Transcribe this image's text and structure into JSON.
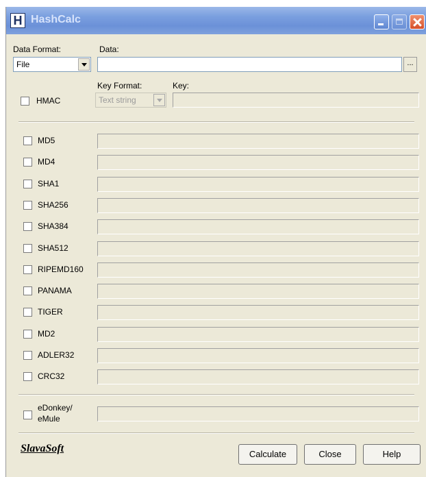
{
  "window": {
    "title": "HashCalc",
    "icon_letter": "H"
  },
  "data_format": {
    "label": "Data Format:",
    "selected": "File"
  },
  "data": {
    "label": "Data:",
    "value": "",
    "browse_label": "..."
  },
  "hmac": {
    "label": "HMAC",
    "key_format_label": "Key Format:",
    "key_format_selected": "Text string",
    "key_label": "Key:"
  },
  "algorithms": [
    {
      "label": "MD5"
    },
    {
      "label": "MD4"
    },
    {
      "label": "SHA1"
    },
    {
      "label": "SHA256"
    },
    {
      "label": "SHA384"
    },
    {
      "label": "SHA512"
    },
    {
      "label": "RIPEMD160"
    },
    {
      "label": "PANAMA"
    },
    {
      "label": "TIGER"
    },
    {
      "label": "MD2"
    },
    {
      "label": "ADLER32"
    },
    {
      "label": "CRC32"
    }
  ],
  "edonkey": {
    "line1": "eDonkey/",
    "line2": "eMule"
  },
  "footer": {
    "logo": "SlavaSoft",
    "calculate": "Calculate",
    "close": "Close",
    "help": "Help"
  }
}
